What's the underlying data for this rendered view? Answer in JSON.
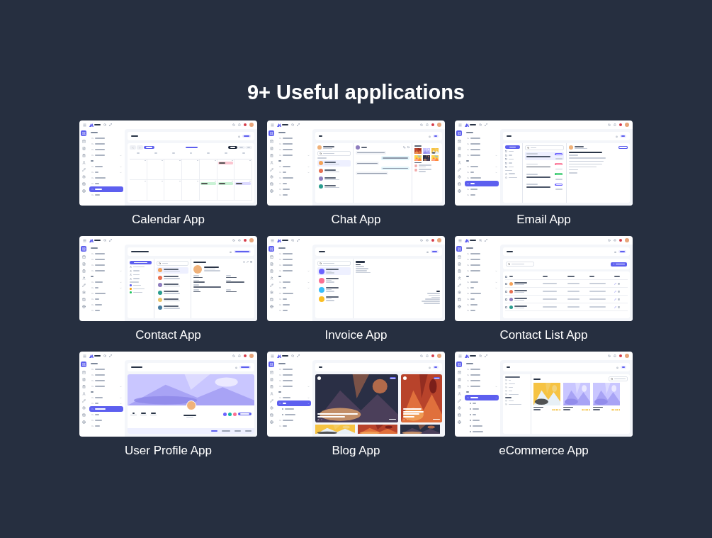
{
  "heading": "9+ Useful applications",
  "apps": [
    {
      "label": "Calendar App",
      "kind": "calendar"
    },
    {
      "label": "Chat App",
      "kind": "chat"
    },
    {
      "label": "Email App",
      "kind": "email"
    },
    {
      "label": "Contact App",
      "kind": "contact"
    },
    {
      "label": "Invoice App",
      "kind": "invoice"
    },
    {
      "label": "Contact List App",
      "kind": "contactlist"
    },
    {
      "label": "User Profile App",
      "kind": "profile"
    },
    {
      "label": "Blog App",
      "kind": "blog"
    },
    {
      "label": "eCommerce App",
      "kind": "shop"
    }
  ]
}
